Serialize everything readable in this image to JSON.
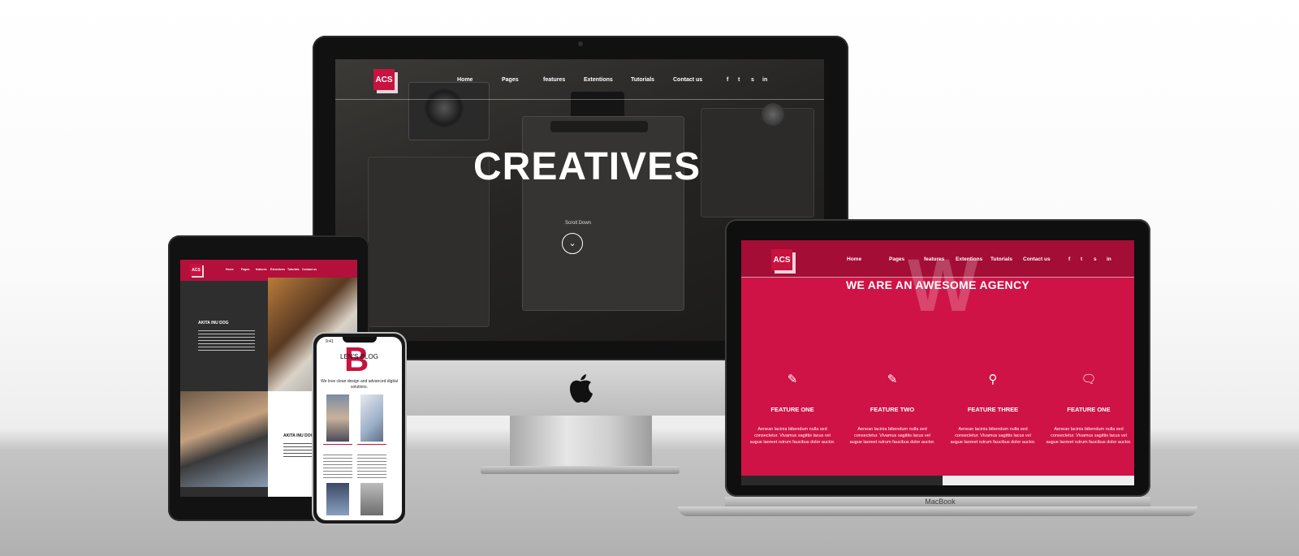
{
  "imac": {
    "logo": "ACS",
    "nav": [
      "Home",
      "Pages",
      "features",
      "Extentions",
      "Tutorials",
      "Contact us"
    ],
    "social": [
      "f",
      "t",
      "s",
      "in"
    ],
    "hero_title": "CREATIVES",
    "scroll_label": "Scroll Down"
  },
  "macbook": {
    "logo": "ACS",
    "nav": [
      "Home",
      "Pages",
      "features",
      "Extentions",
      "Tutorials",
      "Contact us"
    ],
    "social": [
      "f",
      "t",
      "s",
      "in"
    ],
    "big_letter": "W",
    "headline": "WE ARE AN AWESOME AGENCY",
    "brand_label": "MacBook",
    "features": [
      {
        "icon": "edit-icon",
        "title": "FEATURE ONE",
        "desc": "Aenean lacinia bibendum nulla sed consectetur. Vivamus sagittis lacus vel augue laoreet rutrum faucibus dolor auctor."
      },
      {
        "icon": "edit-icon",
        "title": "FEATURE TWO",
        "desc": "Aenean lacinia bibendum nulla sed consectetur. Vivamus sagittis lacus vel augue laoreet rutrum faucibus dolor auctor."
      },
      {
        "icon": "search-icon",
        "title": "FEATURE THREE",
        "desc": "Aenean lacinia bibendum nulla sed consectetur. Vivamus sagittis lacus vel augue laoreet rutrum faucibus dolor auctor."
      },
      {
        "icon": "chat-icon",
        "title": "FEATURE ONE",
        "desc": "Aenean lacinia bibendum nulla sed consectetur. Vivamus sagittis lacus vel augue laoreet rutrum faucibus dolor auctor."
      }
    ]
  },
  "ipad": {
    "logo": "ACS",
    "nav": [
      "Home",
      "Pages",
      "features",
      "Extentions",
      "Tutorials",
      "Contact us"
    ],
    "post_title": "AKITA INU DOG",
    "post_title_2": "AKITA INU DOG"
  },
  "iphone": {
    "time": "9:41",
    "big_letter": "B",
    "title": "LEN'S BLOG",
    "tagline": "We love clean design and advanced digital solutions."
  },
  "colors": {
    "accent": "#c8123f",
    "macbook_bg": "#cf1346",
    "dark": "#1b1a19"
  }
}
